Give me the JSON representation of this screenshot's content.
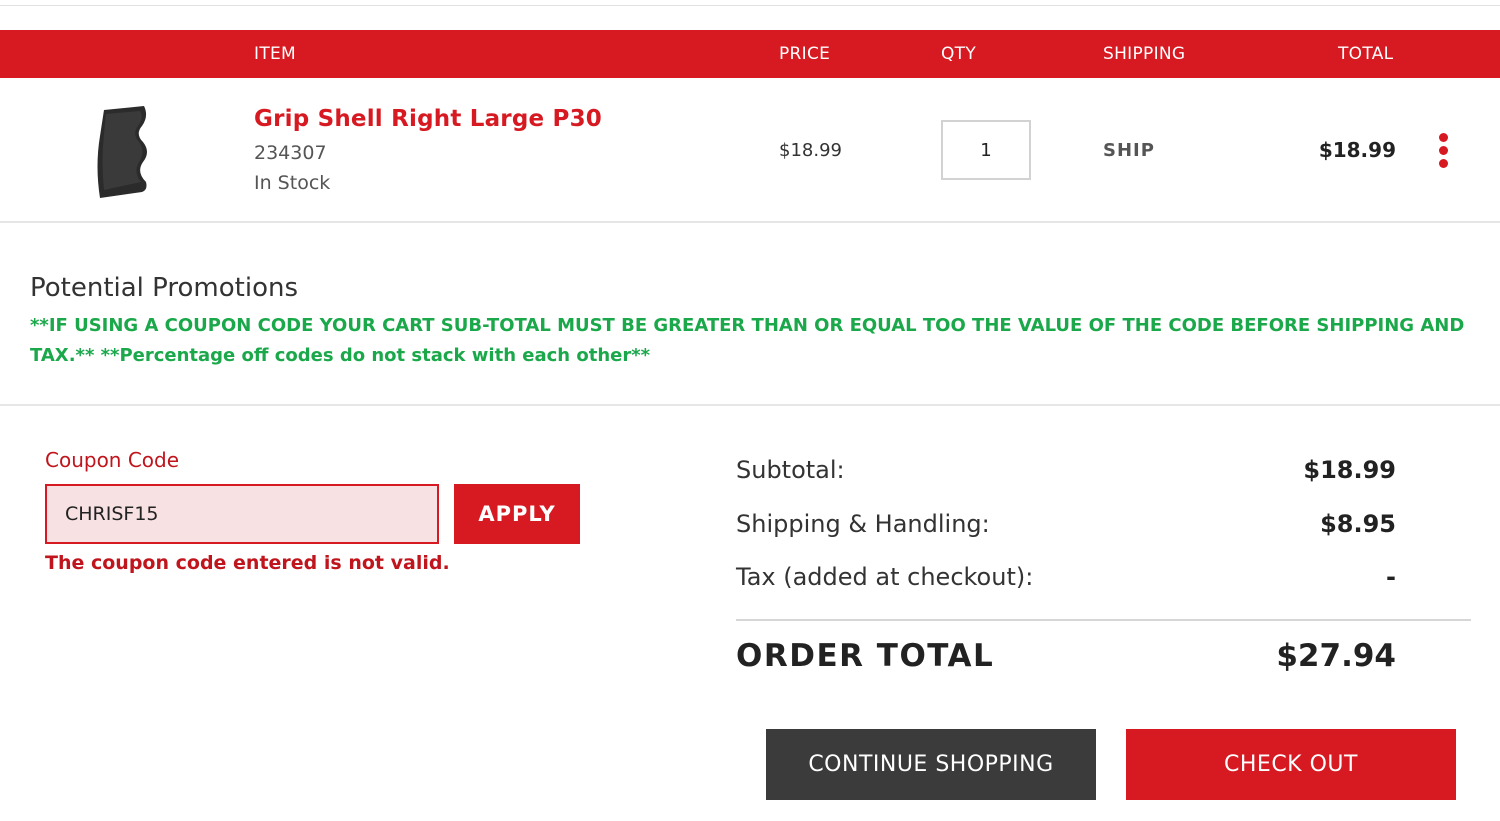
{
  "colors": {
    "brand_red": "#d71921",
    "promo_green": "#1aa84a",
    "dark_button": "#3b3b3b",
    "coupon_field_bg": "#f7e1e2"
  },
  "cart_header": {
    "item": "ITEM",
    "price": "PRICE",
    "qty": "QTY",
    "shipping": "SHIPPING",
    "total": "TOTAL"
  },
  "cart_items": [
    {
      "image_icon": "grip-shell-image",
      "name": "Grip Shell Right Large P30",
      "sku": "234307",
      "stock": "In Stock",
      "price": "$18.99",
      "qty": "1",
      "shipping": "SHIP",
      "total": "$18.99",
      "menu_icon": "kebab-menu-icon"
    }
  ],
  "promotions": {
    "title": "Potential Promotions",
    "note": "**IF USING A COUPON CODE YOUR CART SUB-TOTAL MUST BE GREATER THAN OR EQUAL TOO THE VALUE OF THE CODE BEFORE SHIPPING AND TAX.** **Percentage off codes do not stack with each other**"
  },
  "coupon": {
    "label": "Coupon Code",
    "value": "CHRISF15",
    "apply_label": "APPLY",
    "error": "The coupon code entered is not valid."
  },
  "summary": {
    "subtotal_label": "Subtotal:",
    "subtotal_value": "$18.99",
    "shipping_label": "Shipping & Handling:",
    "shipping_value": "$8.95",
    "tax_label": "Tax (added at checkout):",
    "tax_value": "-",
    "order_total_label": "ORDER TOTAL",
    "order_total_value": "$27.94"
  },
  "actions": {
    "continue_label": "CONTINUE SHOPPING",
    "checkout_label": "CHECK OUT"
  }
}
